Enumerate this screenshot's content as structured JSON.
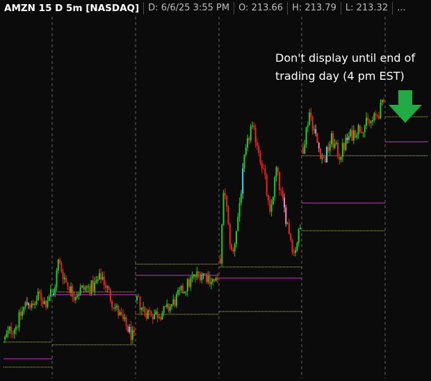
{
  "header": {
    "symbol": "AMZN 15 D 5m [NASDAQ]",
    "date": "D: 6/6/25 3:55 PM",
    "open": "O: 213.66",
    "high": "H: 213.79",
    "low": "L: 213.32",
    "more": "..."
  },
  "annotation": {
    "line1": "Don't display until end of",
    "line2": "trading day (4 pm EST)"
  },
  "colors": {
    "background": "#0b0b0b",
    "up": "#22cc22",
    "down": "#ee2222",
    "up_highlight": "#44dddd",
    "down_highlight": "#ff88bb",
    "pivot": "#cccc33",
    "midline": "#cc33cc",
    "separator": "#666666",
    "arrow": "#22aa44"
  },
  "chart_data": {
    "type": "line",
    "symbol": "AMZN",
    "interval": "5m",
    "ylim": [
      205.2,
      218.2
    ],
    "sessions": [
      {
        "path": [
          [
            0,
            206.6
          ],
          [
            0.1,
            206.9
          ],
          [
            0.25,
            207.1
          ],
          [
            0.35,
            207.5
          ],
          [
            0.5,
            208.0
          ],
          [
            0.6,
            207.7
          ],
          [
            0.75,
            208.2
          ],
          [
            0.88,
            207.9
          ],
          [
            1,
            208.3
          ]
        ],
        "levels": {
          "high": 206.5,
          "mid": 205.9,
          "low": 205.6
        }
      },
      {
        "path": [
          [
            0,
            208.2
          ],
          [
            0.06,
            209.4
          ],
          [
            0.15,
            208.7
          ],
          [
            0.25,
            208.2
          ],
          [
            0.35,
            208.4
          ],
          [
            0.5,
            208.5
          ],
          [
            0.6,
            208.9
          ],
          [
            0.72,
            208.0
          ],
          [
            0.85,
            207.3
          ],
          [
            1,
            206.6
          ]
        ],
        "levels": {
          "high": 208.3,
          "mid": 208.2,
          "low": 206.4
        }
      },
      {
        "path": [
          [
            0,
            208.0
          ],
          [
            0.1,
            207.6
          ],
          [
            0.22,
            207.5
          ],
          [
            0.35,
            207.6
          ],
          [
            0.45,
            207.9
          ],
          [
            0.55,
            208.3
          ],
          [
            0.7,
            208.8
          ],
          [
            0.8,
            209.0
          ],
          [
            0.9,
            208.8
          ],
          [
            1,
            208.6
          ]
        ],
        "levels": {
          "high": 209.3,
          "mid": 208.9,
          "low": 207.5
        }
      },
      {
        "path": [
          [
            0,
            209.5
          ],
          [
            0.05,
            212.2
          ],
          [
            0.1,
            210.6
          ],
          [
            0.15,
            209.5
          ],
          [
            0.22,
            211.0
          ],
          [
            0.3,
            213.0
          ],
          [
            0.38,
            214.2
          ],
          [
            0.45,
            213.8
          ],
          [
            0.55,
            212.5
          ],
          [
            0.62,
            211.0
          ],
          [
            0.7,
            212.7
          ],
          [
            0.78,
            211.5
          ],
          [
            0.86,
            210.5
          ],
          [
            0.92,
            209.7
          ],
          [
            1,
            210.6
          ]
        ],
        "levels": {
          "high": 209.2,
          "mid": 208.8,
          "low": 207.6
        }
      },
      {
        "path": [
          [
            0,
            213.5
          ],
          [
            0.08,
            214.8
          ],
          [
            0.18,
            213.6
          ],
          [
            0.26,
            213.0
          ],
          [
            0.35,
            213.8
          ],
          [
            0.45,
            213.2
          ],
          [
            0.55,
            213.8
          ],
          [
            0.65,
            214.1
          ],
          [
            0.75,
            214.3
          ],
          [
            0.85,
            214.4
          ],
          [
            0.93,
            214.7
          ],
          [
            1,
            215.1
          ]
        ],
        "levels": {
          "high": 213.2,
          "mid": 211.5,
          "low": 210.5
        }
      },
      {
        "path": [],
        "levels": {
          "high": 214.6,
          "mid": 213.7,
          "low": 213.2
        }
      }
    ]
  }
}
